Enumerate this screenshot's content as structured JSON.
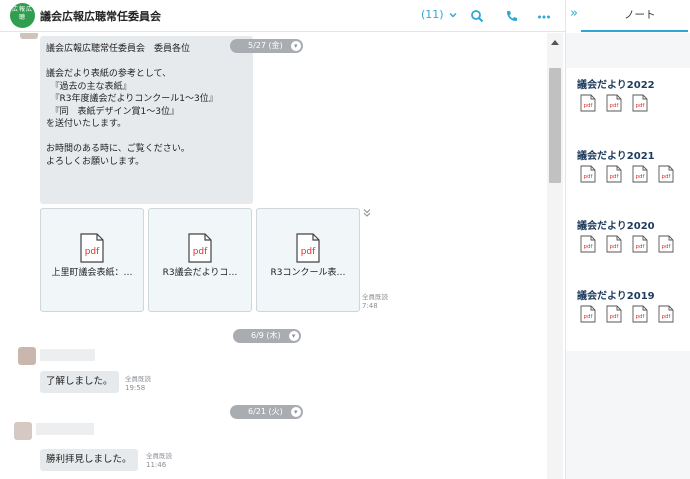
{
  "header": {
    "logo_text": "広報広聴",
    "title": "議会広報広聴常任委員会",
    "member_count": "(11)",
    "icons": [
      "chevron-down-icon",
      "search-icon",
      "phone-icon",
      "more-icon"
    ]
  },
  "chat": {
    "messages": [
      {
        "date": "5/27 (金)",
        "lines": [
          "議会広報広聴常任委員会　委員各位",
          "",
          "議会だより表紙の参考として、",
          "　『過去の主な表紙』",
          "　『R3年度議会だよりコンクール1～3位』",
          "　『同　表紙デザイン賞1～3位』",
          "を送付いたします。",
          "",
          "お時間のある時に、ご覧ください。",
          "よろしくお願いします。"
        ],
        "files": [
          {
            "name": "上里町議会表紙：…",
            "icon": "pdf-file-icon",
            "pdf_label": "pdf"
          },
          {
            "name": "R3議会だよりコ…",
            "icon": "pdf-file-icon",
            "pdf_label": "pdf"
          },
          {
            "name": "R3コンクール表…",
            "icon": "pdf-file-icon",
            "pdf_label": "pdf"
          }
        ],
        "read_status": "全員既読",
        "time": "7:48"
      },
      {
        "date": "6/9 (木)",
        "text": "了解しました。",
        "read_status": "全員既読",
        "time": "19:58"
      },
      {
        "date": "6/21 (火)",
        "text": "勝利拝見しました。",
        "read_status": "全員既読",
        "time": "11:46"
      }
    ]
  },
  "note_panel": {
    "title": "ノート",
    "collapse_icon": "double-chevron-right-icon",
    "items": [
      {
        "title": "議会だより2022",
        "pdf_count": 3
      },
      {
        "title": "議会だより2021",
        "pdf_count": 4
      },
      {
        "title": "議会だより2020",
        "pdf_count": 4
      },
      {
        "title": "議会だより2019",
        "pdf_count": 4
      }
    ],
    "pdf_label": "pdf"
  },
  "colors": {
    "accent": "#2fa7d6",
    "pdf_red": "#e0302a",
    "logo_green": "#2f9e4e",
    "date_pill": "#a9adb2"
  }
}
